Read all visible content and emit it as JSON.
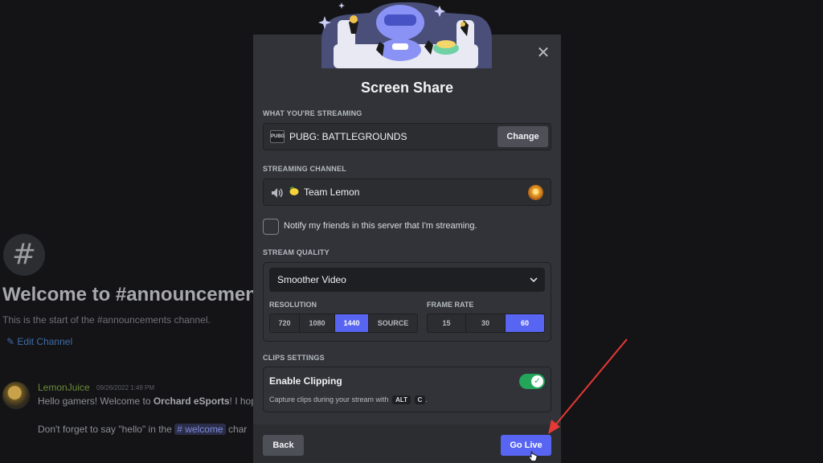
{
  "background": {
    "hash_symbol": "#",
    "welcome_title": "Welcome to #announcemen",
    "start_text": "This is the start of the #announcements channel.",
    "edit_channel": "Edit Channel",
    "message": {
      "author": "LemonJuice",
      "timestamp": "09/26/2022 1:49 PM",
      "line1_prefix": "Hello gamers! Welcome to ",
      "line1_bold": "Orchard eSports",
      "line1_suffix": "! I hop",
      "line2_prefix": "Don't forget to say \"hello\" in the ",
      "line2_mention": "# welcome",
      "line2_suffix": " char"
    }
  },
  "modal": {
    "title": "Screen Share",
    "close_symbol": "✕",
    "streaming": {
      "label": "WHAT YOU'RE STREAMING",
      "game_icon_text": "PUBG",
      "game_name": "PUBG: BATTLEGROUNDS",
      "change_label": "Change"
    },
    "channel": {
      "label": "STREAMING CHANNEL",
      "name": "Team Lemon"
    },
    "notify": {
      "label": "Notify my friends in this server that I'm streaming.",
      "checked": false
    },
    "quality": {
      "label": "STREAM QUALITY",
      "selected": "Smoother Video",
      "resolution_label": "RESOLUTION",
      "resolution_options": [
        "720",
        "1080",
        "1440",
        "SOURCE"
      ],
      "resolution_selected": "1440",
      "framerate_label": "FRAME RATE",
      "framerate_options": [
        "15",
        "30",
        "60"
      ],
      "framerate_selected": "60"
    },
    "clips": {
      "label": "CLIPS SETTINGS",
      "title": "Enable Clipping",
      "enabled": true,
      "toggle_check": "✓",
      "description": "Capture clips during your stream with",
      "key1": "ALT",
      "key2": "C",
      "period": "."
    },
    "footer": {
      "back_label": "Back",
      "go_live_label": "Go Live"
    }
  },
  "colors": {
    "accent": "#5865f2",
    "toggle_on": "#23a55a",
    "arrow": "#e53935"
  }
}
